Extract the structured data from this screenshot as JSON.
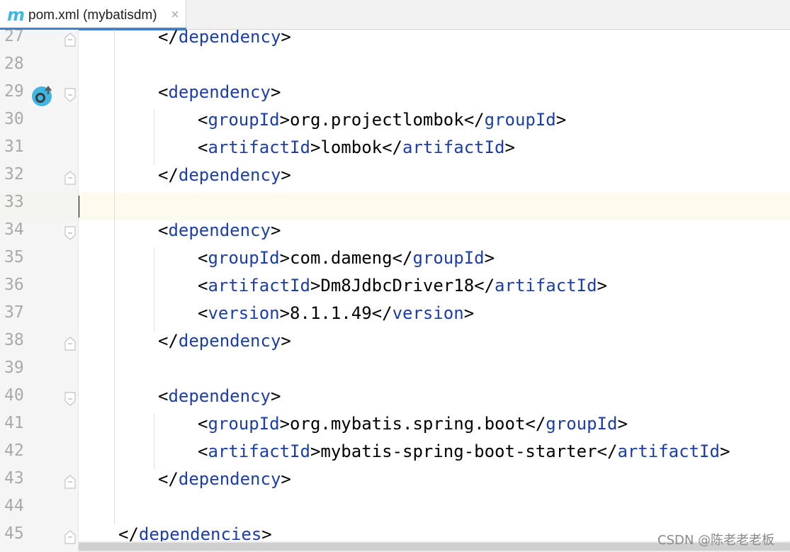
{
  "tab": {
    "icon": "maven-m-icon",
    "icon_glyph": "m",
    "title": "pom.xml (mybatisdm)",
    "close": "×"
  },
  "editor": {
    "current_line": 33,
    "lines": [
      {
        "n": "27",
        "indent": 1,
        "parts": [
          [
            "</",
            "p"
          ],
          [
            "dependency",
            "t"
          ],
          [
            ">",
            "p"
          ]
        ],
        "fold": "end"
      },
      {
        "n": "28",
        "indent": 0,
        "parts": []
      },
      {
        "n": "29",
        "indent": 1,
        "parts": [
          [
            "<",
            "p"
          ],
          [
            "dependency",
            "t"
          ],
          [
            ">",
            "p"
          ]
        ],
        "fold": "start",
        "marker": true
      },
      {
        "n": "30",
        "indent": 2,
        "parts": [
          [
            "<",
            "p"
          ],
          [
            "groupId",
            "t"
          ],
          [
            ">org.projectlombok</",
            "p"
          ],
          [
            "groupId",
            "t"
          ],
          [
            ">",
            "p"
          ]
        ]
      },
      {
        "n": "31",
        "indent": 2,
        "parts": [
          [
            "<",
            "p"
          ],
          [
            "artifactId",
            "t"
          ],
          [
            ">lombok</",
            "p"
          ],
          [
            "artifactId",
            "t"
          ],
          [
            ">",
            "p"
          ]
        ]
      },
      {
        "n": "32",
        "indent": 1,
        "parts": [
          [
            "</",
            "p"
          ],
          [
            "dependency",
            "t"
          ],
          [
            ">",
            "p"
          ]
        ],
        "fold": "end"
      },
      {
        "n": "33",
        "indent": 0,
        "parts": []
      },
      {
        "n": "34",
        "indent": 1,
        "parts": [
          [
            "<",
            "p"
          ],
          [
            "dependency",
            "t"
          ],
          [
            ">",
            "p"
          ]
        ],
        "fold": "start"
      },
      {
        "n": "35",
        "indent": 2,
        "parts": [
          [
            "<",
            "p"
          ],
          [
            "groupId",
            "t"
          ],
          [
            ">com.dameng</",
            "p"
          ],
          [
            "groupId",
            "t"
          ],
          [
            ">",
            "p"
          ]
        ]
      },
      {
        "n": "36",
        "indent": 2,
        "parts": [
          [
            "<",
            "p"
          ],
          [
            "artifactId",
            "t"
          ],
          [
            ">Dm8JdbcDriver18</",
            "p"
          ],
          [
            "artifactId",
            "t"
          ],
          [
            ">",
            "p"
          ]
        ]
      },
      {
        "n": "37",
        "indent": 2,
        "parts": [
          [
            "<",
            "p"
          ],
          [
            "version",
            "t"
          ],
          [
            ">8.1.1.49</",
            "p"
          ],
          [
            "version",
            "t"
          ],
          [
            ">",
            "p"
          ]
        ]
      },
      {
        "n": "38",
        "indent": 1,
        "parts": [
          [
            "</",
            "p"
          ],
          [
            "dependency",
            "t"
          ],
          [
            ">",
            "p"
          ]
        ],
        "fold": "end"
      },
      {
        "n": "39",
        "indent": 0,
        "parts": []
      },
      {
        "n": "40",
        "indent": 1,
        "parts": [
          [
            "<",
            "p"
          ],
          [
            "dependency",
            "t"
          ],
          [
            ">",
            "p"
          ]
        ],
        "fold": "start"
      },
      {
        "n": "41",
        "indent": 2,
        "parts": [
          [
            "<",
            "p"
          ],
          [
            "groupId",
            "t"
          ],
          [
            ">org.mybatis.spring.boot</",
            "p"
          ],
          [
            "groupId",
            "t"
          ],
          [
            ">",
            "p"
          ]
        ]
      },
      {
        "n": "42",
        "indent": 2,
        "parts": [
          [
            "<",
            "p"
          ],
          [
            "artifactId",
            "t"
          ],
          [
            ">mybatis-spring-boot-starter</",
            "p"
          ],
          [
            "artifactId",
            "t"
          ],
          [
            ">",
            "p"
          ]
        ]
      },
      {
        "n": "43",
        "indent": 1,
        "parts": [
          [
            "</",
            "p"
          ],
          [
            "dependency",
            "t"
          ],
          [
            ">",
            "p"
          ]
        ],
        "fold": "end"
      },
      {
        "n": "44",
        "indent": 0,
        "parts": []
      },
      {
        "n": "45",
        "indent": 0,
        "parts": [
          [
            "</",
            "p"
          ],
          [
            "dependencies",
            "t"
          ],
          [
            ">",
            "p"
          ]
        ],
        "fold": "end"
      }
    ]
  },
  "colors": {
    "tag": "#1b3ea8",
    "text": "#000000",
    "line_number": "#a9a9a9",
    "current_line_bg": "#fcfaed",
    "tab_accent": "#4083c9",
    "gutter_marker": "#40b6e0"
  },
  "gutter_marker_icon": "override-method-icon",
  "watermark": "CSDN @陈老老老板"
}
